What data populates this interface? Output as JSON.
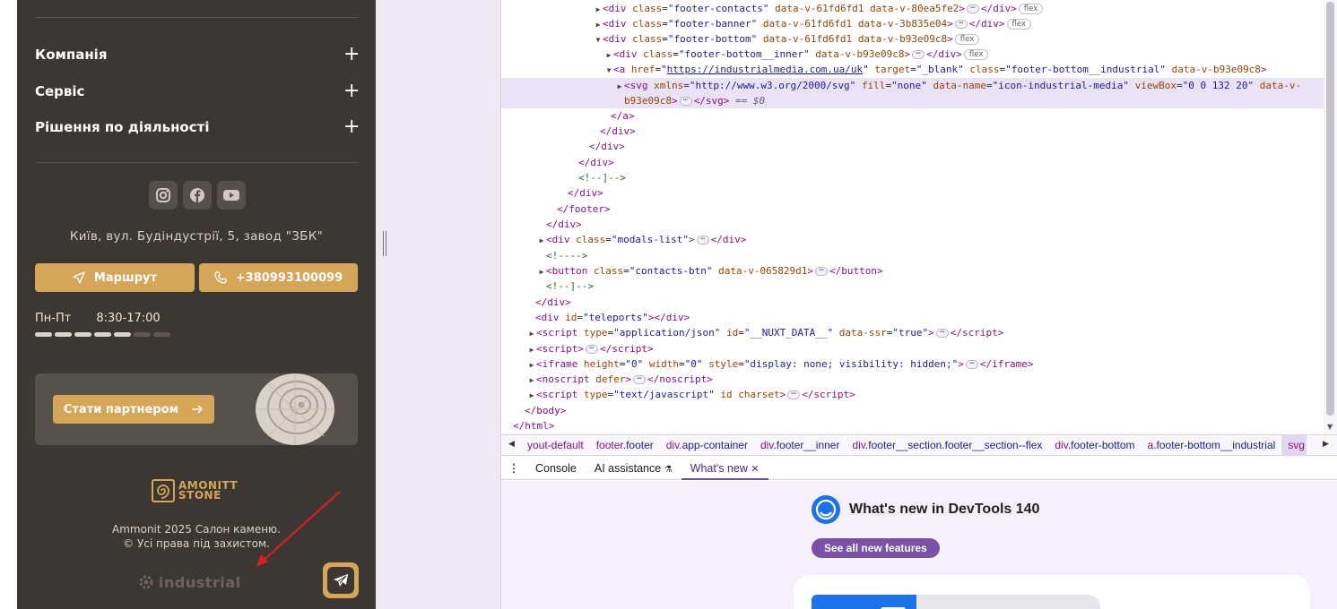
{
  "footer": {
    "accordion": [
      {
        "label": "Компанія",
        "toggle": "+"
      },
      {
        "label": "Сервіс",
        "toggle": "+"
      },
      {
        "label": "Рішення по діяльності",
        "toggle": "+"
      }
    ],
    "socials": [
      "instagram-icon",
      "facebook-icon",
      "youtube-icon"
    ],
    "address": "Київ, вул. Будіндустрії, 5, завод \"ЗБК\"",
    "route_button": "Маршрут",
    "phone_button": "+380993100099",
    "hours": {
      "days": "Пн-Пт",
      "time": "8:30-17:00",
      "bar_filled": 5,
      "bar_total": 7
    },
    "partner_button": "Стати партнером",
    "logo": {
      "line1": "AMONITT",
      "line2": "STONE"
    },
    "copyright_line1": "Ammonit 2025 Салон каменю.",
    "copyright_line2": "© Усі права під захистом.",
    "industrial_logo": "industrial",
    "colors": {
      "bg": "#3c3732",
      "accent": "#d6a658"
    }
  },
  "devtools": {
    "breadcrumbs": [
      {
        "tag": "yout-default",
        "cls": ""
      },
      {
        "tag": "footer",
        "cls": ".footer"
      },
      {
        "tag": "div",
        "cls": ".app-container"
      },
      {
        "tag": "div",
        "cls": ".footer__inner"
      },
      {
        "tag": "div",
        "cls": ".footer__section.footer__section--flex"
      },
      {
        "tag": "div",
        "cls": ".footer-bottom"
      },
      {
        "tag": "a",
        "cls": ".footer-bottom__industrial"
      },
      {
        "tag": "svg",
        "cls": ""
      }
    ],
    "drawer_tabs": {
      "console": "Console",
      "ai": "AI assistance",
      "ai_icon": "⚗",
      "whats_new": "What's new",
      "close": "✕"
    },
    "whats_new": {
      "title": "What's new in DevTools 140",
      "button": "See all new features"
    }
  }
}
